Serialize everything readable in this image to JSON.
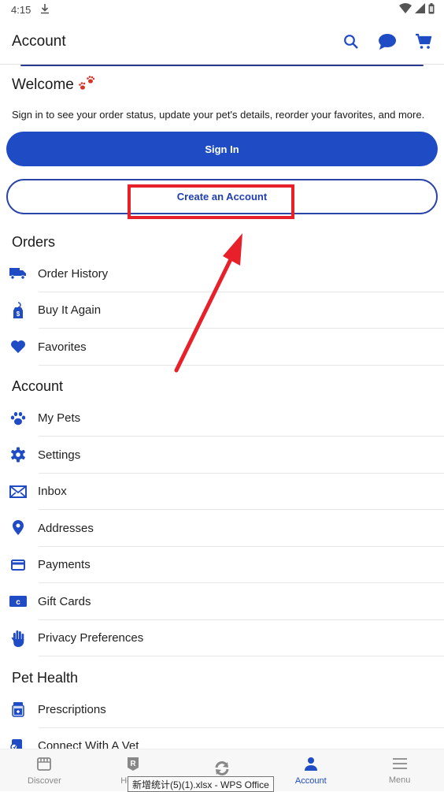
{
  "status_bar": {
    "time": "4:15",
    "download_icon": "download-icon",
    "wifi_icon": "wifi-icon",
    "signal_icon": "signal-icon",
    "battery_icon": "battery-icon"
  },
  "app_bar": {
    "title": "Account",
    "actions": [
      "search-icon",
      "chat-icon",
      "cart-icon"
    ]
  },
  "welcome": {
    "title": "Welcome",
    "subtitle": "Sign in to see your order status, update your pet's details, reorder your favorites, and more.",
    "sign_in_label": "Sign In",
    "create_account_label": "Create an Account"
  },
  "sections": [
    {
      "title": "Orders",
      "items": [
        {
          "label": "Order History",
          "icon": "truck-icon"
        },
        {
          "label": "Buy It Again",
          "icon": "price-tag-icon"
        },
        {
          "label": "Favorites",
          "icon": "heart-icon"
        }
      ]
    },
    {
      "title": "Account",
      "items": [
        {
          "label": "My Pets",
          "icon": "paw-icon"
        },
        {
          "label": "Settings",
          "icon": "gear-icon"
        },
        {
          "label": "Inbox",
          "icon": "envelope-icon"
        },
        {
          "label": "Addresses",
          "icon": "location-pin-icon"
        },
        {
          "label": "Payments",
          "icon": "credit-card-icon"
        },
        {
          "label": "Gift Cards",
          "icon": "gift-card-icon"
        },
        {
          "label": "Privacy Preferences",
          "icon": "hand-icon"
        }
      ]
    },
    {
      "title": "Pet Health",
      "items": [
        {
          "label": "Prescriptions",
          "icon": "pill-bottle-icon"
        },
        {
          "label": "Connect With A Vet",
          "icon": "vet-chat-icon"
        }
      ]
    }
  ],
  "bottom_nav": [
    {
      "label": "Discover",
      "icon": "storefront-icon",
      "active": false
    },
    {
      "label": "Health",
      "icon": "rx-icon",
      "active": false
    },
    {
      "label": "",
      "icon": "autoship-icon",
      "active": false
    },
    {
      "label": "Account",
      "icon": "person-icon",
      "active": true
    },
    {
      "label": "Menu",
      "icon": "hamburger-icon",
      "active": false
    }
  ],
  "tooltip": "新增统计(5)(1).xlsx - WPS Office",
  "colors": {
    "brand_blue": "#1f4bc4",
    "annotation_red": "#e8202a",
    "paw_red": "#d2362b"
  }
}
